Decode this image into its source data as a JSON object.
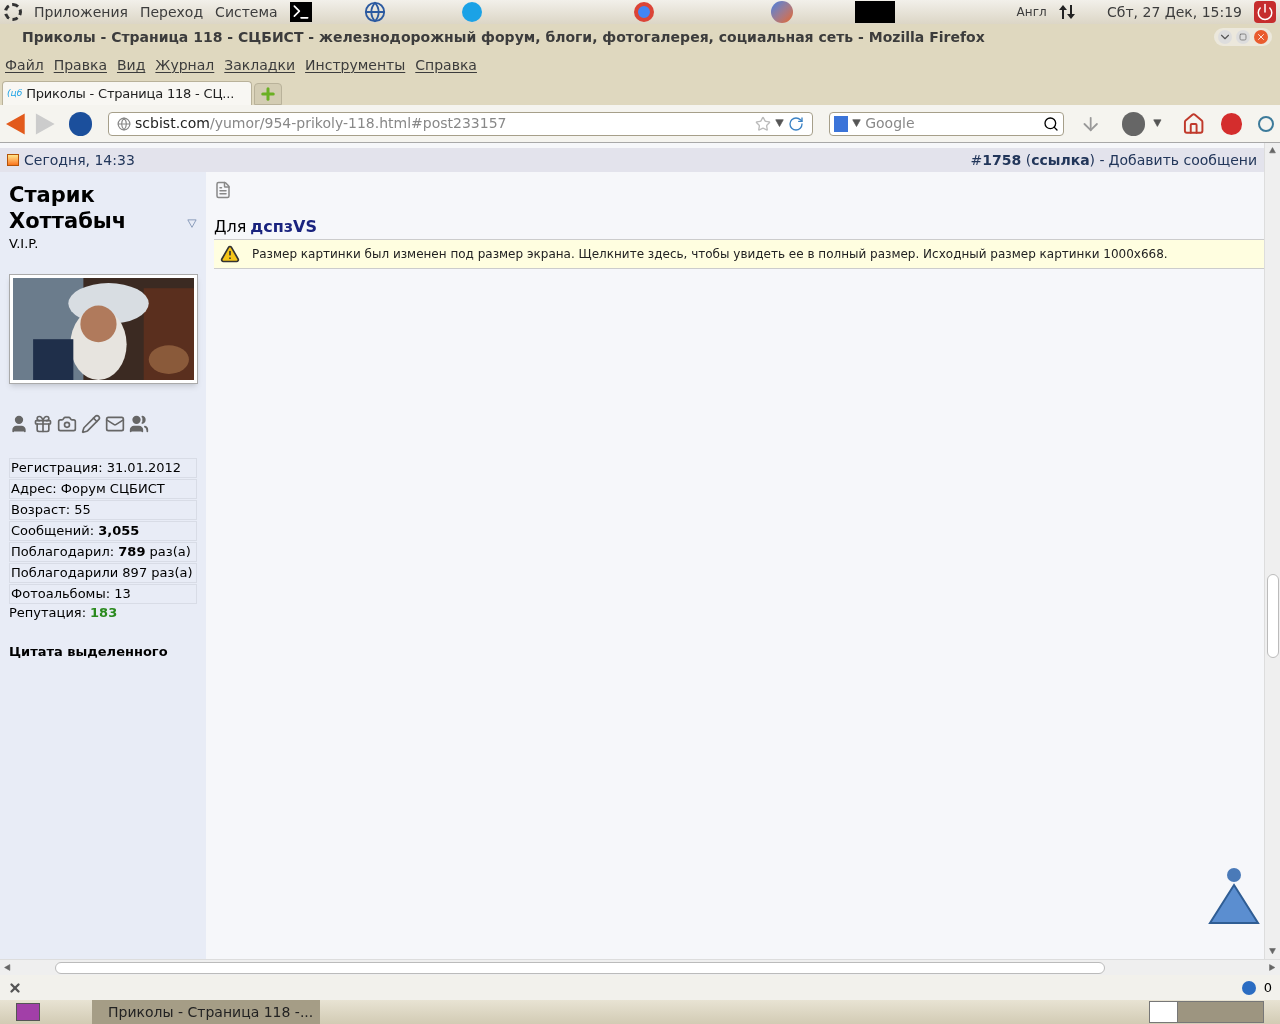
{
  "top_panel": {
    "menus": [
      "Приложения",
      "Переход",
      "Система"
    ],
    "keyboard": "Англ",
    "clock": "Сбт, 27 Дек, 15:19"
  },
  "window": {
    "title": "Приколы - Страница 118 - СЦБИСТ - железнодорожный форум, блоги, фотогалерея, социальная сеть - Mozilla Firefox"
  },
  "menu_bar": [
    "Файл",
    "Правка",
    "Вид",
    "Журнал",
    "Закладки",
    "Инструменты",
    "Справка"
  ],
  "tabs": [
    {
      "favicon": "(цб",
      "label": "Приколы - Страница 118 - СЦ...",
      "selected": true
    }
  ],
  "address_bar": {
    "host": "scbist.com",
    "path": "/yumor/954-prikoly-118.html#post233157"
  },
  "search": {
    "placeholder": "Google"
  },
  "post": {
    "date": "Сегодня, 14:33",
    "number": "#**1758** (**ссылка**) -",
    "add_link": "Добавить сообщени",
    "user": {
      "name": "Старик Хоттабыч",
      "rank": "V.I.P.",
      "stats": [
        "Регистрация: 31.01.2012",
        "Адрес: Форум СЦБИСТ",
        "Возраст: 55",
        "Сообщений: **3,055**",
        "Поблагодарил: **789** раз(а)",
        "Поблагодарили 897 раз(а)",
        "Фотоальбомы: 13"
      ],
      "reputation_label": "Репутация:",
      "reputation_value": "183",
      "quote": "Цитата выделенного"
    },
    "message": {
      "prefix": "Для",
      "mention": "дспзVS",
      "notice": "Размер картинки был изменен под размер экрана. Щелкните здесь, чтобы увидеть ее в полный размер. Исходный размер картинки 1000x668."
    }
  },
  "status_bar": {
    "count": "0"
  },
  "taskbar": [
    {
      "label": "Приколы - Страница 118 -...",
      "selected": true
    }
  ]
}
